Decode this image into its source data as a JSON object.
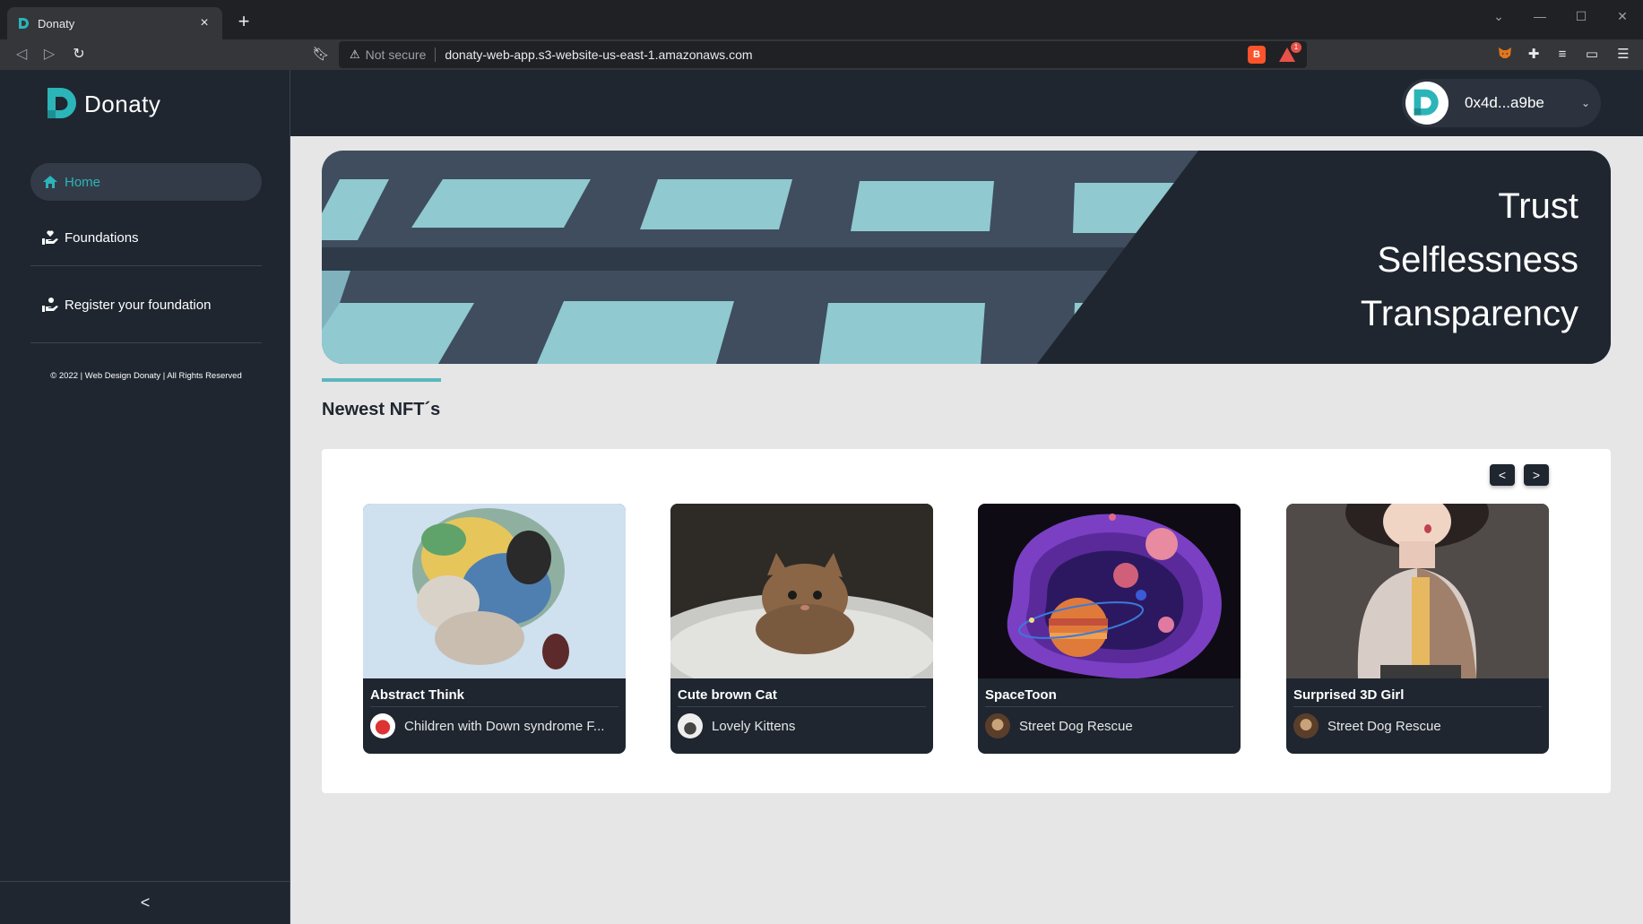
{
  "browser": {
    "tab_title": "Donaty",
    "tab_close": "×",
    "new_tab": "+",
    "not_secure": "Not secure",
    "url": "donaty-web-app.s3-website-us-east-1.amazonaws.com",
    "rewards_badge": "1"
  },
  "sidebar": {
    "logo_text": "Donaty",
    "nav": {
      "home": "Home",
      "foundations": "Foundations",
      "register": "Register your foundation"
    },
    "copyright": "© 2022 | Web Design Donaty | All Rights Reserved",
    "collapse": "<"
  },
  "topbar": {
    "wallet_address": "0x4d...a9be"
  },
  "hero": {
    "words": [
      "Trust",
      "Selflessness",
      "Transparency"
    ]
  },
  "section": {
    "title": "Newest NFT´s"
  },
  "carousel": {
    "prev": "<",
    "next": ">"
  },
  "nfts": [
    {
      "title": "Abstract Think",
      "foundation": "Children with Down syndrome F..."
    },
    {
      "title": "Cute brown Cat",
      "foundation": "Lovely Kittens"
    },
    {
      "title": "SpaceToon",
      "foundation": "Street Dog Rescue"
    },
    {
      "title": "Surprised 3D Girl",
      "foundation": "Street Dog Rescue"
    }
  ],
  "colors": {
    "brand": "#2bb5b8",
    "dark": "#1f2630",
    "accent_line": "#5ab7bd"
  }
}
